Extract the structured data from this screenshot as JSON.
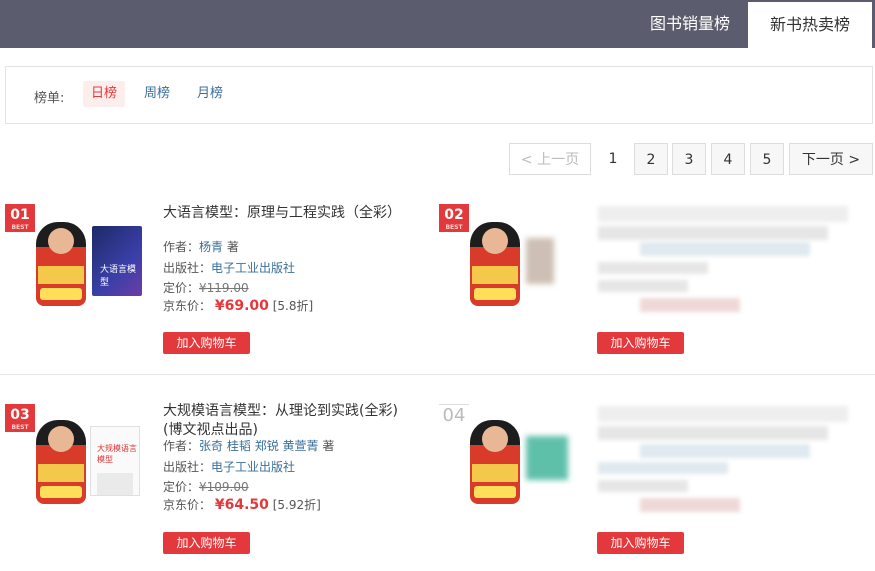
{
  "tabs": {
    "sales": "图书销量榜",
    "new": "新书热卖榜"
  },
  "filter": {
    "label": "榜单:",
    "periods": [
      "日榜",
      "周榜",
      "月榜"
    ]
  },
  "pagination": {
    "prev": "< 上一页",
    "pages": [
      "1",
      "2",
      "3",
      "4",
      "5"
    ],
    "next": "下一页 >"
  },
  "books": [
    {
      "rank": "01",
      "badge": "BEST",
      "cover_text": "大语言模型",
      "title": "大语言模型：原理与工程实践（全彩）",
      "author_label": "作者：",
      "author": "杨青",
      "author_suffix": "著",
      "publisher_label": "出版社：",
      "publisher": "电子工业出版社",
      "list_price_label": "定价：",
      "list_price": "¥119.00",
      "jd_price_label": "京东价：",
      "jd_price": "¥69.00",
      "discount": "[5.8折]",
      "cart": "加入购物车"
    },
    {
      "rank": "02",
      "badge": "BEST",
      "cart": "加入购物车"
    },
    {
      "rank": "03",
      "badge": "BEST",
      "cover_text": "大规模语言模型",
      "title_line1": "大规模语言模型：从理论到实践(全彩)",
      "title_line2": "(博文视点出品)",
      "author_label": "作者：",
      "authors": [
        "张奇",
        "桂韬",
        "郑锐",
        "黄萱菁"
      ],
      "author_suffix": "著",
      "publisher_label": "出版社：",
      "publisher": "电子工业出版社",
      "list_price_label": "定价：",
      "list_price": "¥109.00",
      "jd_price_label": "京东价：",
      "jd_price": "¥64.50",
      "discount": "[5.92折]",
      "cart": "加入购物车"
    },
    {
      "rank": "04",
      "cart": "加入购物车"
    }
  ],
  "colors": {
    "accent": "#e4393c",
    "topbar": "#5b5d6e",
    "link": "#3b6f9a"
  }
}
